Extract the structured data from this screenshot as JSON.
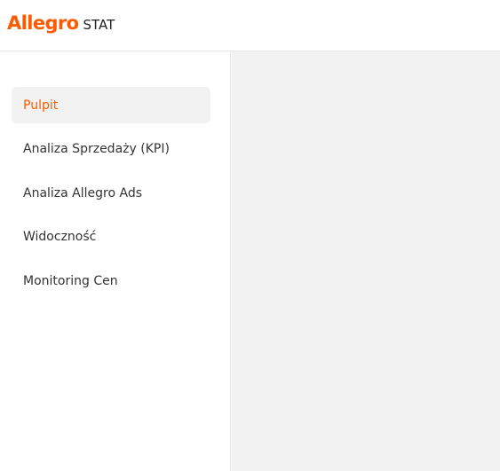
{
  "header": {
    "logo_brand": "Allegro",
    "logo_suffix": "STAT"
  },
  "sidebar": {
    "items": [
      {
        "label": "Pulpit",
        "active": true
      },
      {
        "label": "Analiza Sprzedaży (KPI)",
        "active": false
      },
      {
        "label": "Analiza Allegro Ads",
        "active": false
      },
      {
        "label": "Widoczność",
        "active": false
      },
      {
        "label": "Monitoring Cen",
        "active": false
      }
    ]
  },
  "colors": {
    "brand": "#ff5a00",
    "active_text": "#ff5a00",
    "text": "#333333",
    "active_bg": "#f2f2f3",
    "content_bg": "#f2f2f3",
    "border": "#e5e5e5"
  }
}
